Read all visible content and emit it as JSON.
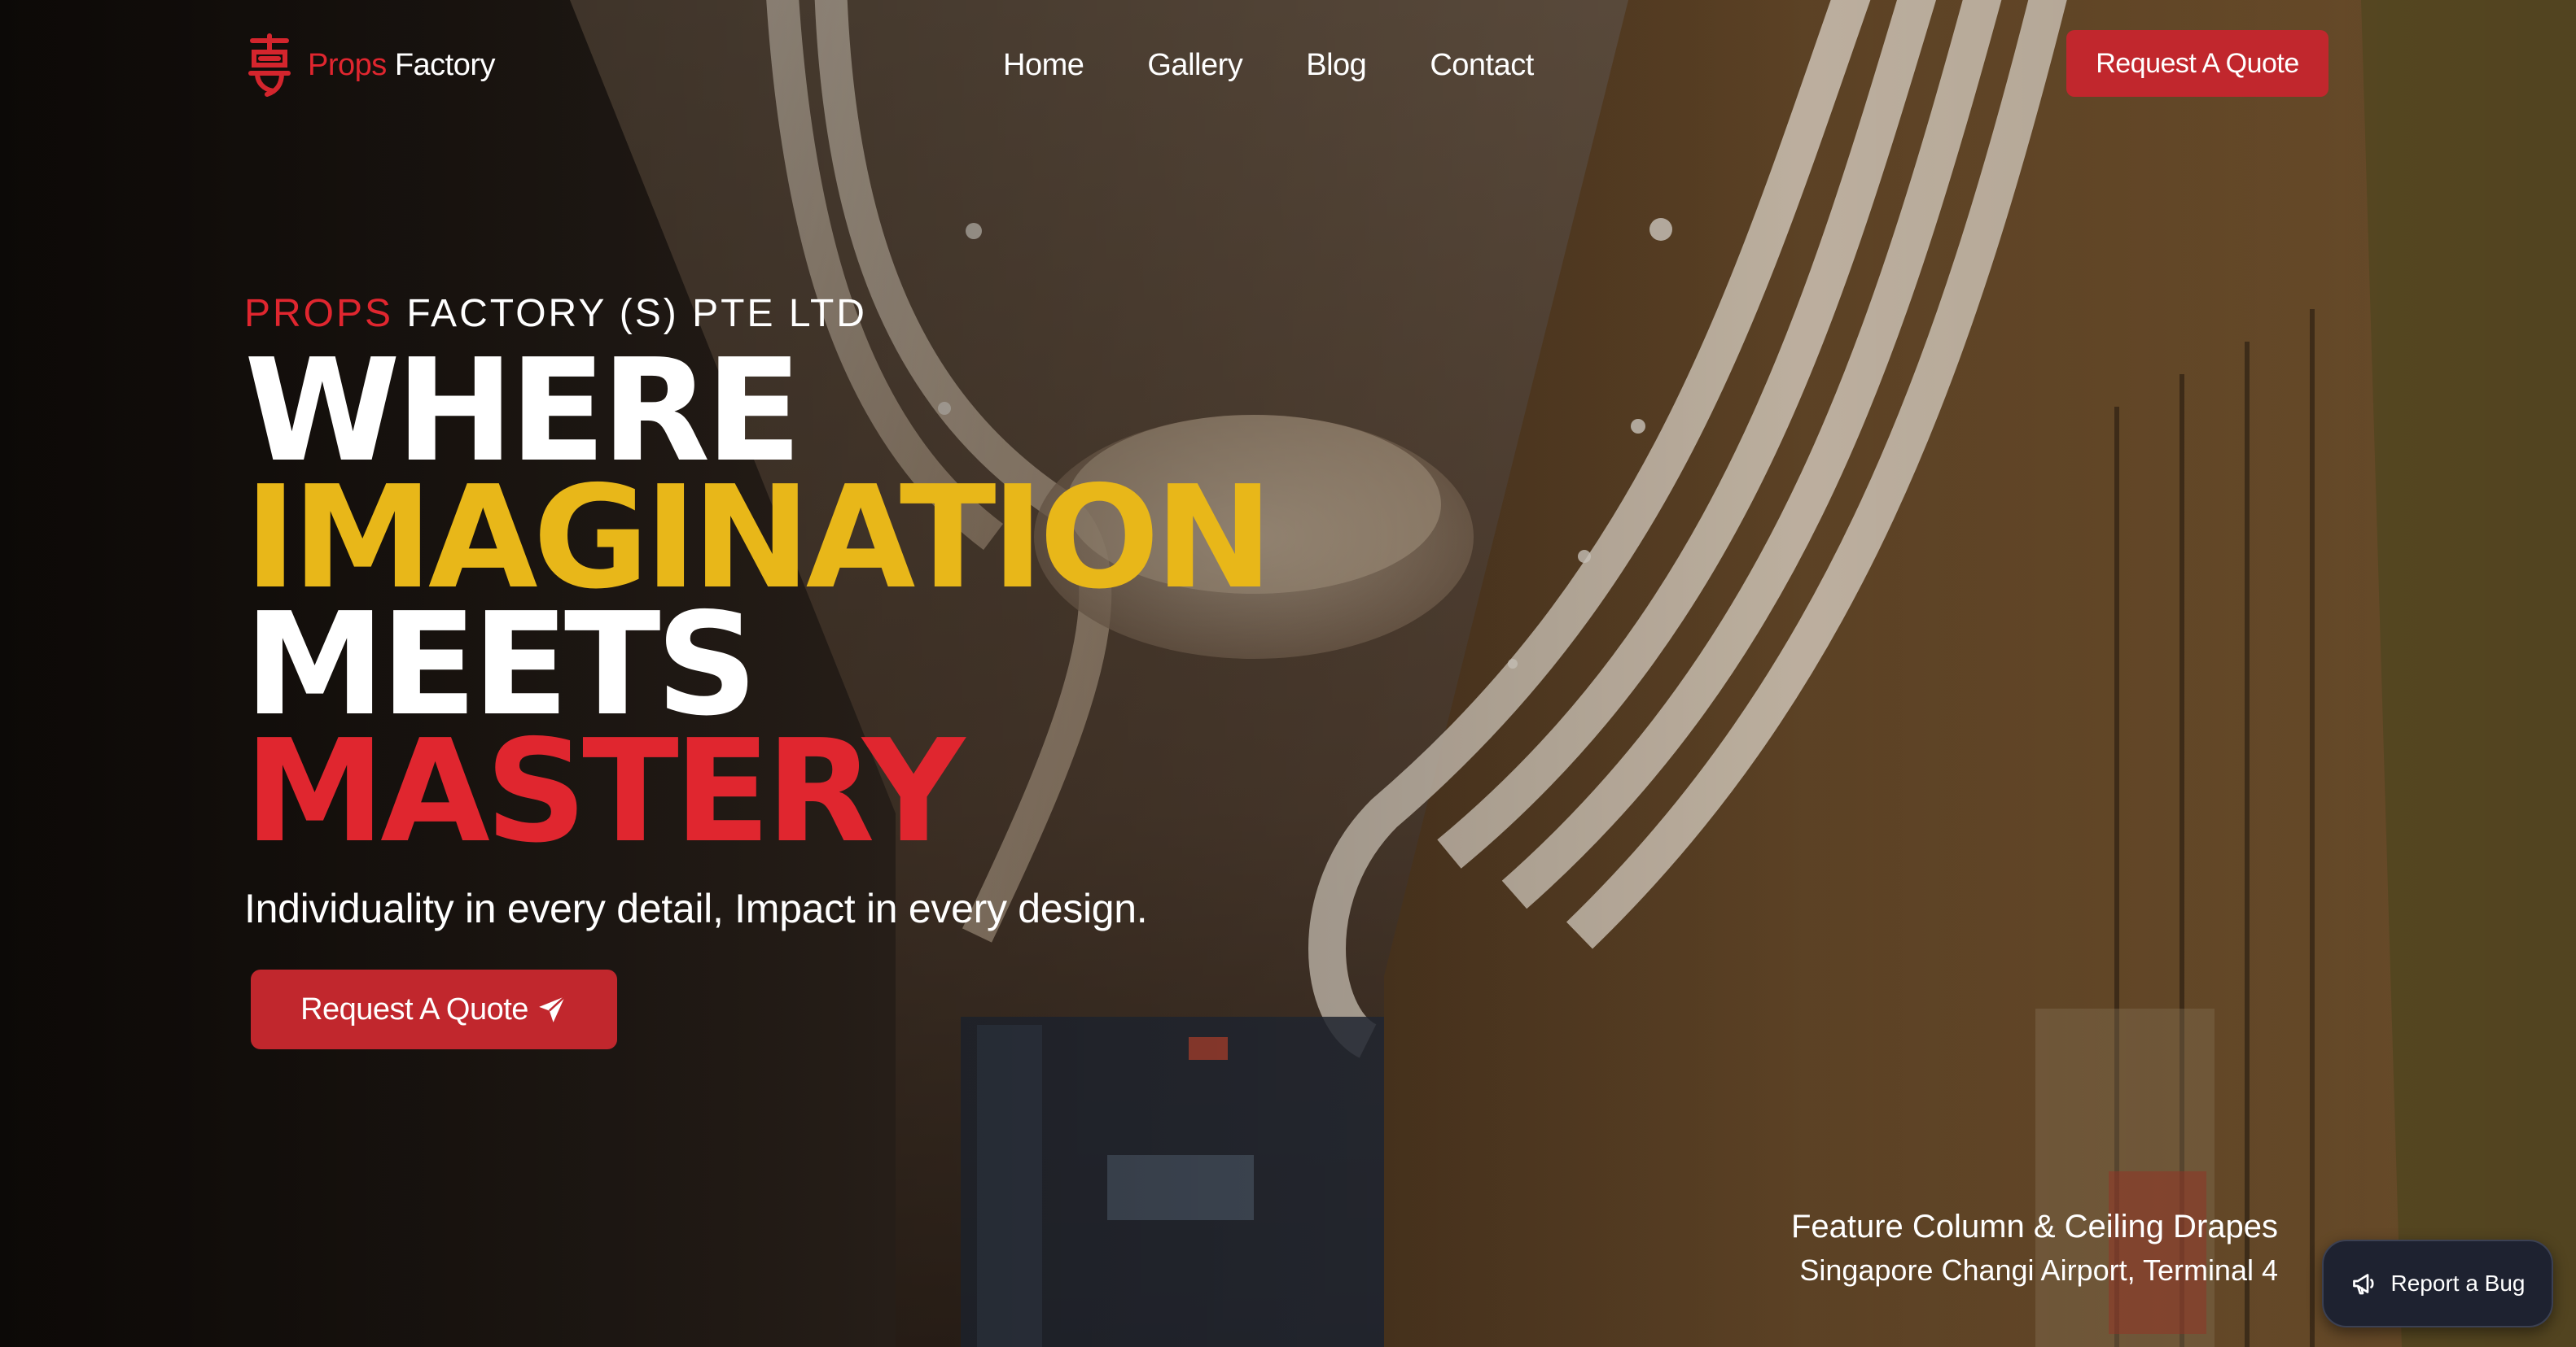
{
  "brand": {
    "name_accent": "Props",
    "name_rest": " Factory",
    "logo_icon": "chinese-seal-logo-icon",
    "accent_color": "#e0262f"
  },
  "nav": {
    "items": [
      {
        "label": "Home"
      },
      {
        "label": "Gallery"
      },
      {
        "label": "Blog"
      },
      {
        "label": "Contact"
      }
    ],
    "cta_label": "Request A Quote"
  },
  "hero": {
    "eyebrow_accent": "PROPS",
    "eyebrow_rest": " FACTORY (S) PTE LTD",
    "headline": {
      "line1": "WHERE",
      "line2": "IMAGINATION",
      "line3": "MEETS",
      "line4": "MASTERY"
    },
    "headline_colors": {
      "white": "#ffffff",
      "yellow": "#e8b719",
      "red": "#e0262f"
    },
    "tagline": "Individuality in every detail, Impact in every design.",
    "cta_label": "Request A Quote",
    "cta_icon": "paper-plane-icon"
  },
  "caption": {
    "title": "Feature Column & Ceiling Drapes",
    "location": "Singapore Changi Airport, Terminal 4"
  },
  "bug_report": {
    "label": "Report a Bug",
    "icon": "megaphone-icon"
  }
}
